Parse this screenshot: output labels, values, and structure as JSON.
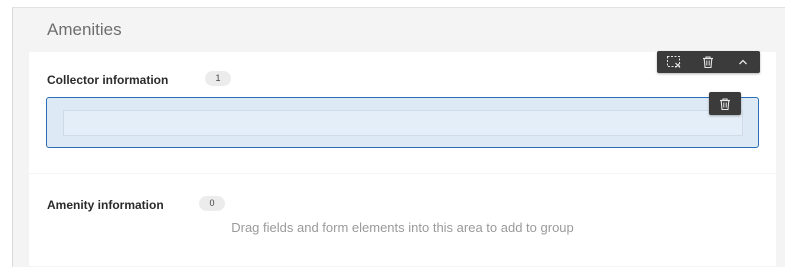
{
  "page": {
    "title": "Amenities"
  },
  "groups": [
    {
      "title": "Collector information",
      "count": "1"
    },
    {
      "title": "Amenity information",
      "count": "0",
      "empty_hint": "Drag fields and form elements into this area to add to group"
    }
  ],
  "toolbar": {
    "icons": [
      "ungroup-icon",
      "trash-icon",
      "chevron-up-icon"
    ]
  },
  "floating_delete": {
    "icon": "trash-icon"
  },
  "colors": {
    "selection_border": "#2a6fb3",
    "selection_fill": "#dde9f5",
    "toolbar_bg": "#3b3b3b"
  }
}
